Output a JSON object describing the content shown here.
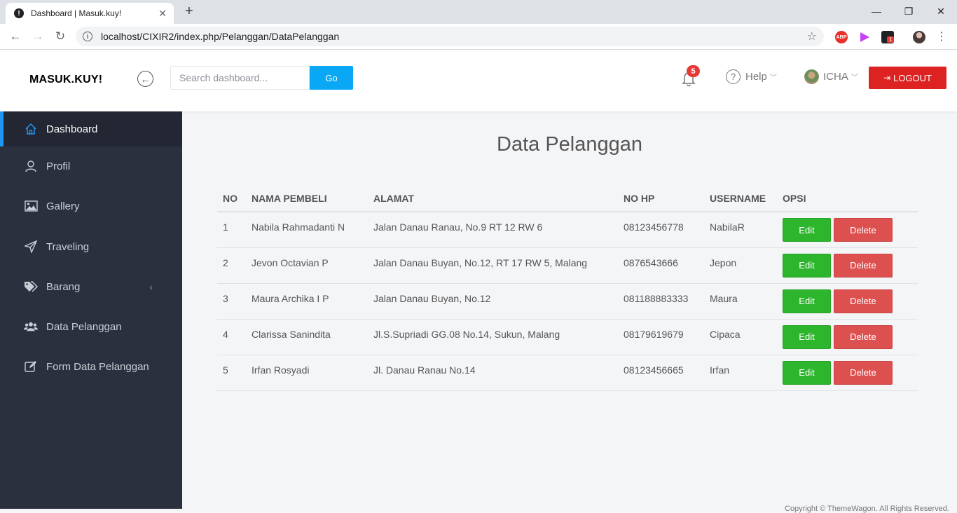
{
  "browser": {
    "tab_title": "Dashboard | Masuk.kuy!",
    "tab_close": "✕",
    "new_tab": "+",
    "url": "localhost/CIXIR2/index.php/Pelanggan/DataPelanggan",
    "ext_badge": "1",
    "abp": "ABP"
  },
  "header": {
    "logo": "MASUK.KUY!",
    "search_placeholder": "Search dashboard...",
    "go_label": "Go",
    "notification_count": "5",
    "help_label": "Help",
    "user_name": "ICHA",
    "logout_label": "LOGOUT"
  },
  "sidebar": {
    "items": [
      {
        "label": "Dashboard"
      },
      {
        "label": "Profil"
      },
      {
        "label": "Gallery"
      },
      {
        "label": "Traveling"
      },
      {
        "label": "Barang"
      },
      {
        "label": "Data Pelanggan"
      },
      {
        "label": "Form Data Pelanggan"
      }
    ]
  },
  "main": {
    "title": "Data Pelanggan",
    "columns": [
      "NO",
      "NAMA PEMBELI",
      "ALAMAT",
      "NO HP",
      "USERNAME",
      "OPSI"
    ],
    "rows": [
      {
        "no": "1",
        "nama": "Nabila Rahmadanti N",
        "alamat": "Jalan Danau Ranau, No.9 RT 12 RW 6",
        "hp": "08123456778",
        "username": "NabilaR"
      },
      {
        "no": "2",
        "nama": "Jevon Octavian P",
        "alamat": "Jalan Danau Buyan, No.12, RT 17 RW 5, Malang",
        "hp": "0876543666",
        "username": "Jepon"
      },
      {
        "no": "3",
        "nama": "Maura Archika I P",
        "alamat": "Jalan Danau Buyan, No.12",
        "hp": "081188883333",
        "username": "Maura"
      },
      {
        "no": "4",
        "nama": "Clarissa Sanindita",
        "alamat": "Jl.S.Supriadi GG.08 No.14, Sukun, Malang",
        "hp": "08179619679",
        "username": "Cipaca"
      },
      {
        "no": "5",
        "nama": "Irfan Rosyadi",
        "alamat": "Jl. Danau Ranau No.14",
        "hp": "08123456665",
        "username": "Irfan"
      }
    ],
    "edit_label": "Edit",
    "delete_label": "Delete"
  },
  "footer": {
    "text": "Copyright © ThemeWagon. All Rights Reserved."
  },
  "colors": {
    "accent": "#0aa8f4",
    "logout": "#dd2222",
    "edit": "#2db52d",
    "delete": "#dd5050",
    "sidebar": "#2a303d",
    "active_indicator": "#2196f3"
  }
}
